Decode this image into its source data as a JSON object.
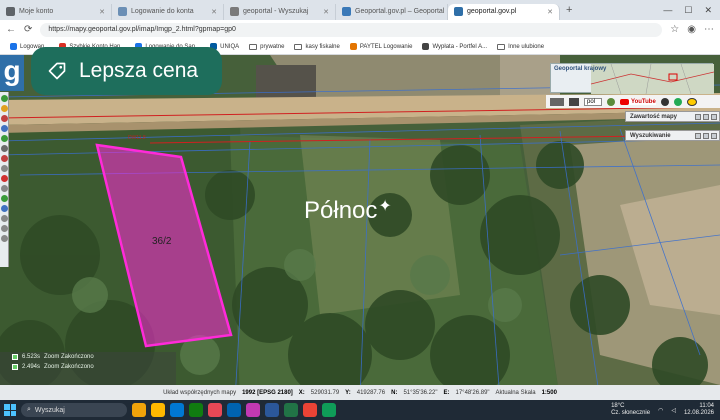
{
  "browser": {
    "tabs": [
      {
        "label": "Moje konto",
        "color": "#5f6368",
        "active": false
      },
      {
        "label": "Logowanie do konta",
        "color": "#6b8fb5",
        "active": false
      },
      {
        "label": "geoportal - Wyszukaj",
        "color": "#7a7a7a",
        "active": false
      },
      {
        "label": "Geoportal.gov.pl – Geoportal Inf...",
        "color": "#3a79b8",
        "active": false
      },
      {
        "label": "geoportal.gov.pl",
        "color": "#2f6fa8",
        "active": true
      }
    ],
    "new_tab": "+",
    "url": "https://mapy.geoportal.gov.pl/imap/Imgp_2.html?gpmap=gp0",
    "bookmarks": [
      {
        "label": "Logowan...",
        "kind": "site",
        "color": "#1a73e8"
      },
      {
        "label": "Szybkie Konto Han...",
        "kind": "site",
        "color": "#d93025"
      },
      {
        "label": "Logowanie do San...",
        "kind": "site",
        "color": "#1a73e8"
      },
      {
        "label": "UNIQA",
        "kind": "site",
        "color": "#005aa0"
      },
      {
        "label": "prywatne",
        "kind": "folder",
        "color": "#666666"
      },
      {
        "label": "kasy fiskalne",
        "kind": "folder",
        "color": "#666666"
      },
      {
        "label": "PAYTEL Logowanie",
        "kind": "site",
        "color": "#e37400"
      },
      {
        "label": "Wypłata - Portfel A...",
        "kind": "site",
        "color": "#444444"
      },
      {
        "label": "Inne ulubione",
        "kind": "folder",
        "color": "#666666"
      }
    ]
  },
  "map": {
    "logo_letter": "g",
    "price_badge": "Lepsza cena",
    "parcel_label": "36/2",
    "road_label": "DW11.8",
    "north_label": "Północ",
    "minimap_title": "Geoportal krajowy",
    "tool_select": "pol",
    "youtube": "YouTube",
    "panels": [
      "Zawartość mapy",
      "Wyszukiwanie"
    ],
    "layers": [
      {
        "value": "6.523s",
        "label": "Zoom  Zakończono"
      },
      {
        "value": "2.494s",
        "label": "Zoom  Zakończono"
      }
    ],
    "parcel_color": "#ff2ad9"
  },
  "statusbar": {
    "system_label": "Układ współrzędnych mapy",
    "system_value": "1992 [EPSG 2180]",
    "x_label": "X:",
    "x_value": "529031.79",
    "y_label": "Y:",
    "y_value": "419287.76",
    "n_label": "N:",
    "n_value": "51°35'36.22\"",
    "e_label": "E:",
    "e_value": "17°48'26.89\"",
    "scale_label": "Aktualna Skala",
    "scale_value": "1:500"
  },
  "taskbar": {
    "search": "Wyszukaj",
    "apps": [
      "#f0a30a",
      "#ffb900",
      "#0078d4",
      "#107c10",
      "#e74856",
      "#0063b1",
      "#c239b3",
      "#2b579a",
      "#217346",
      "#ea4335",
      "#0f9d58"
    ],
    "temperature": "18°C",
    "weather": "Cz. słonecznie",
    "time": "11:04",
    "date": "12.08.2026"
  }
}
